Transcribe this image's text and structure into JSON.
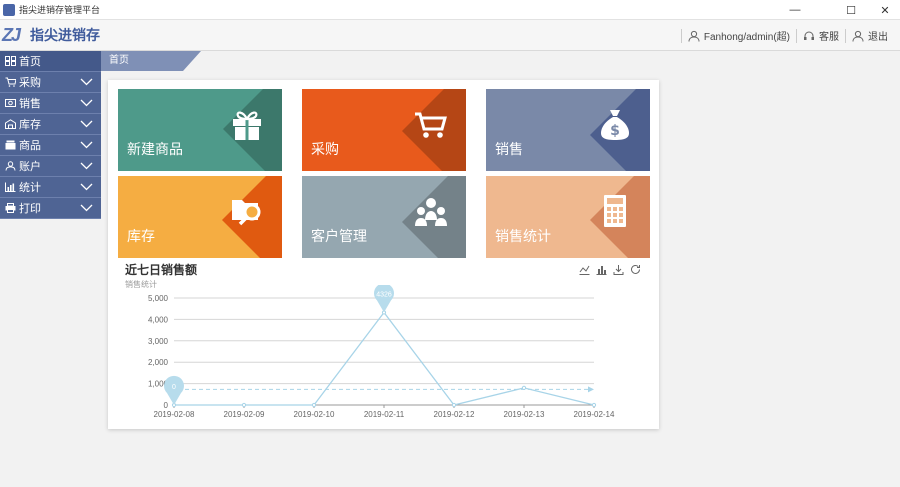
{
  "window": {
    "title": "指尖进销存管理平台",
    "controls": [
      "—",
      "☐",
      "✕"
    ]
  },
  "header": {
    "logo_mark": "ZJ",
    "logo_text": "指尖进销存",
    "user": "Fanhong/admin(超)",
    "service": "客服",
    "logout": "退出"
  },
  "sidebar": {
    "items": [
      {
        "label": "首页",
        "icon": "home-icon",
        "expandable": false
      },
      {
        "label": "采购",
        "icon": "cart-icon",
        "expandable": true
      },
      {
        "label": "销售",
        "icon": "sales-icon",
        "expandable": true
      },
      {
        "label": "库存",
        "icon": "warehouse-icon",
        "expandable": true
      },
      {
        "label": "商品",
        "icon": "goods-icon",
        "expandable": true
      },
      {
        "label": "账户",
        "icon": "account-icon",
        "expandable": true
      },
      {
        "label": "统计",
        "icon": "stats-icon",
        "expandable": true
      },
      {
        "label": "打印",
        "icon": "print-icon",
        "expandable": true
      }
    ]
  },
  "tabs": {
    "home": "首页"
  },
  "tiles": [
    {
      "label": "新建商品",
      "icon": "gift-icon",
      "color": "#4e9a8a"
    },
    {
      "label": "采购",
      "icon": "cart-icon",
      "color": "#e85a1c"
    },
    {
      "label": "销售",
      "icon": "money-bag-icon",
      "color": "#7a89a8"
    },
    {
      "label": "库存",
      "icon": "folder-search-icon",
      "color": "#f5ad42"
    },
    {
      "label": "客户管理",
      "icon": "users-icon",
      "color": "#95a7b0"
    },
    {
      "label": "销售统计",
      "icon": "calculator-icon",
      "color": "#efb88f"
    }
  ],
  "chart": {
    "title": "近七日销售额",
    "subtitle": "销售统计",
    "toolbox": [
      "line-chart-icon",
      "bar-chart-icon",
      "download-icon",
      "refresh-icon"
    ]
  },
  "chart_data": {
    "type": "line",
    "title": "近七日销售额",
    "subtitle": "销售统计",
    "categories": [
      "2019-02-08",
      "2019-02-09",
      "2019-02-10",
      "2019-02-11",
      "2019-02-12",
      "2019-02-13",
      "2019-02-14"
    ],
    "series": [
      {
        "values": [
          0,
          0,
          0,
          4326,
          0,
          800,
          0
        ],
        "color": "#a8d4e8"
      }
    ],
    "ylim": [
      0,
      5000
    ],
    "yticks": [
      "0",
      "1,000",
      "2,000",
      "3,000",
      "4,000",
      "5,000"
    ],
    "markers": [
      {
        "label": "0",
        "index": 0
      },
      {
        "label": "4326",
        "index": 3
      }
    ],
    "average_line": true,
    "grid": true
  }
}
